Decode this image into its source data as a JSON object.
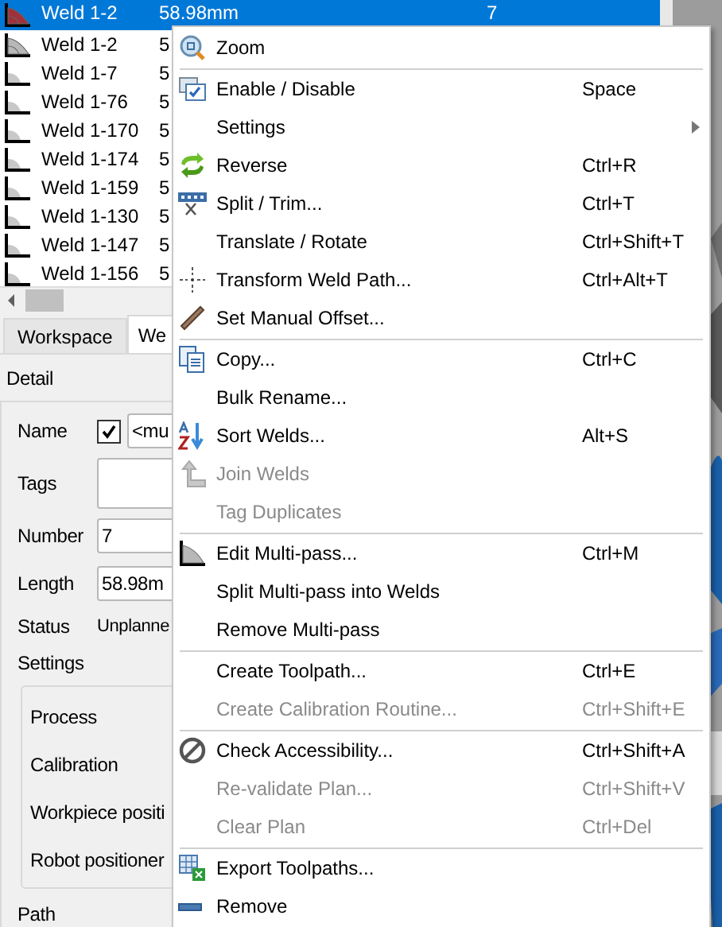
{
  "weld_list": {
    "rows": [
      {
        "name": "Weld 1-2",
        "kind": "multipass",
        "length": "58.98mm",
        "number": "7",
        "selected": true
      },
      {
        "name": "Weld 1-2",
        "kind": "multipass",
        "length": "5",
        "selected": false
      },
      {
        "name": "Weld 1-7",
        "kind": "fillet",
        "length": "5",
        "selected": false
      },
      {
        "name": "Weld 1-76",
        "kind": "fillet",
        "length": "5",
        "selected": false
      },
      {
        "name": "Weld 1-170",
        "kind": "fillet",
        "length": "5",
        "selected": false
      },
      {
        "name": "Weld 1-174",
        "kind": "fillet",
        "length": "5",
        "selected": false
      },
      {
        "name": "Weld 1-159",
        "kind": "fillet",
        "length": "5",
        "selected": false
      },
      {
        "name": "Weld 1-130",
        "kind": "fillet",
        "length": "5",
        "selected": false
      },
      {
        "name": "Weld 1-147",
        "kind": "fillet",
        "length": "5",
        "selected": false
      },
      {
        "name": "Weld 1-156",
        "kind": "fillet",
        "length": "5",
        "selected": false
      }
    ]
  },
  "tabs": [
    {
      "label": "Workspace",
      "selected": false
    },
    {
      "label": "We",
      "selected": true
    }
  ],
  "detail": {
    "title": "Detail",
    "fields": [
      {
        "kind": "checked_field",
        "label": "Name",
        "checked": true,
        "value": "<mu"
      },
      {
        "kind": "area",
        "label": "Tags"
      },
      {
        "kind": "field",
        "label": "Number",
        "value": "7"
      },
      {
        "kind": "field",
        "label": "Length",
        "value": "58.98m"
      },
      {
        "kind": "text",
        "label": "Status",
        "value": "Unplanne"
      }
    ],
    "settings": {
      "title": "Settings",
      "rows": [
        "Process",
        "Calibration",
        "Workpiece positi",
        "Robot positioner"
      ]
    },
    "path_title": "Path"
  },
  "context_menu": {
    "items": [
      {
        "kind": "zoom",
        "label": "Zoom",
        "disabled": false
      },
      {
        "kind": "separator"
      },
      {
        "kind": "enable",
        "label": "Enable / Disable",
        "shortcut": "Space",
        "disabled": false
      },
      {
        "kind": "plain",
        "label": "Settings",
        "submenu": true,
        "disabled": false
      },
      {
        "kind": "reverse",
        "label": "Reverse",
        "shortcut": "Ctrl+R",
        "disabled": false
      },
      {
        "kind": "split",
        "label": "Split / Trim...",
        "shortcut": "Ctrl+T",
        "disabled": false
      },
      {
        "kind": "plain",
        "label": "Translate / Rotate",
        "shortcut": "Ctrl+Shift+T",
        "disabled": false
      },
      {
        "kind": "transform",
        "label": "Transform Weld Path...",
        "shortcut": "Ctrl+Alt+T",
        "disabled": false
      },
      {
        "kind": "offset",
        "label": "Set Manual Offset...",
        "disabled": false
      },
      {
        "kind": "separator"
      },
      {
        "kind": "copy",
        "label": "Copy...",
        "shortcut": "Ctrl+C",
        "disabled": false
      },
      {
        "kind": "plain",
        "label": "Bulk Rename...",
        "disabled": false
      },
      {
        "kind": "sort",
        "label": "Sort Welds...",
        "shortcut": "Alt+S",
        "disabled": false
      },
      {
        "kind": "join",
        "label": "Join Welds",
        "disabled": true
      },
      {
        "kind": "plain",
        "label": "Tag Duplicates",
        "disabled": true
      },
      {
        "kind": "separator"
      },
      {
        "kind": "multipass",
        "label": "Edit Multi-pass...",
        "shortcut": "Ctrl+M",
        "disabled": false
      },
      {
        "kind": "plain",
        "label": "Split Multi-pass into Welds",
        "disabled": false
      },
      {
        "kind": "plain",
        "label": "Remove Multi-pass",
        "disabled": false
      },
      {
        "kind": "separator"
      },
      {
        "kind": "plain",
        "label": "Create Toolpath...",
        "shortcut": "Ctrl+E",
        "disabled": false
      },
      {
        "kind": "plain",
        "label": "Create Calibration Routine...",
        "shortcut": "Ctrl+Shift+E",
        "disabled": true
      },
      {
        "kind": "separator"
      },
      {
        "kind": "forbidden",
        "label": "Check Accessibility...",
        "shortcut": "Ctrl+Shift+A",
        "disabled": false
      },
      {
        "kind": "plain",
        "label": "Re-validate Plan...",
        "shortcut": "Ctrl+Shift+V",
        "disabled": true
      },
      {
        "kind": "plain",
        "label": "Clear Plan",
        "shortcut": "Ctrl+Del",
        "disabled": true
      },
      {
        "kind": "separator"
      },
      {
        "kind": "export",
        "label": "Export Toolpaths...",
        "disabled": false
      },
      {
        "kind": "remove",
        "label": "Remove",
        "disabled": false
      }
    ]
  }
}
